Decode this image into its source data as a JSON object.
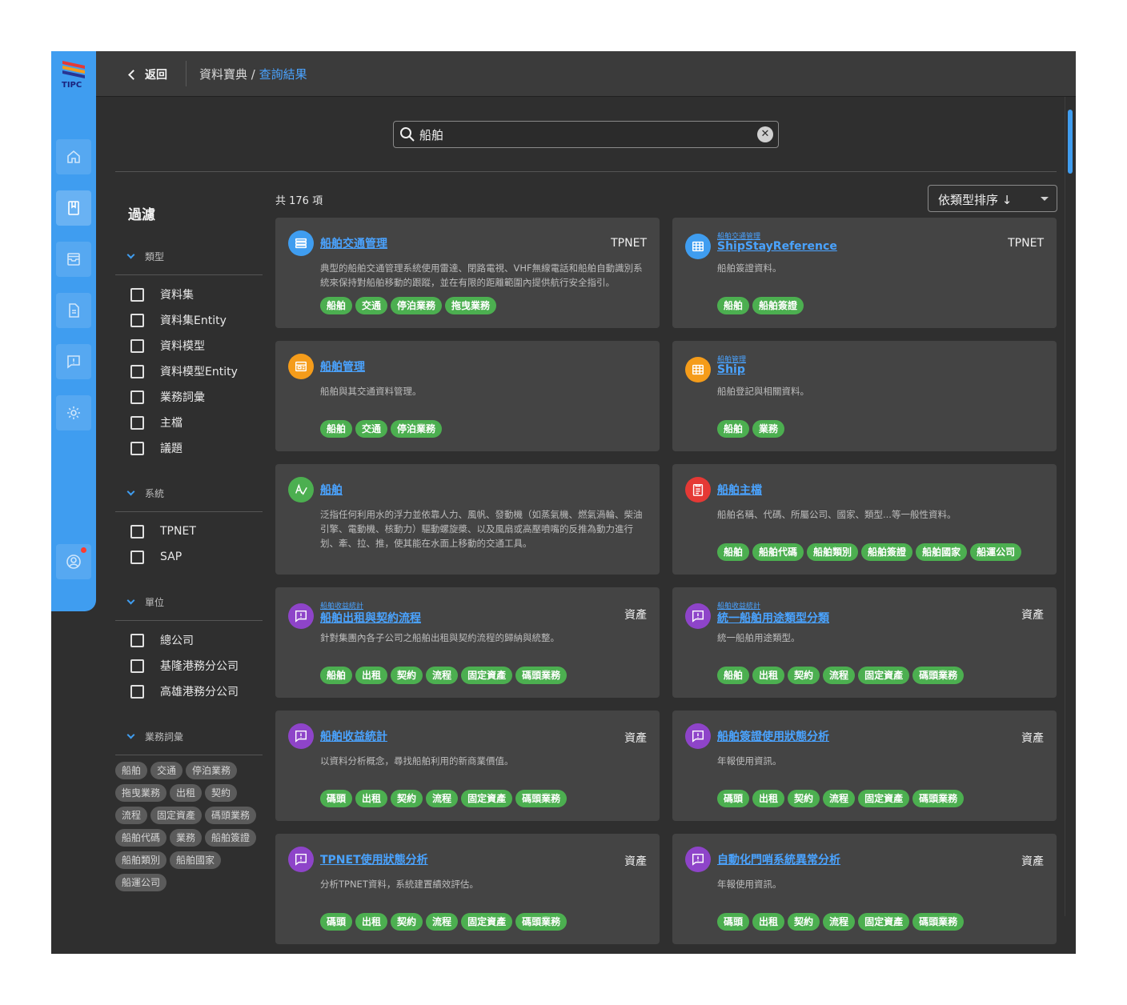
{
  "header": {
    "back_label": "返回",
    "breadcrumb_root": "資料寶典",
    "breadcrumb_sep": " / ",
    "breadcrumb_current": "查詢結果"
  },
  "brand": {
    "logo_text": "TIPC",
    "rail_color": "#3f9df0"
  },
  "rail": {
    "items": [
      "home-icon",
      "book-icon",
      "inbox-icon",
      "document-icon",
      "issue-icon",
      "gear-icon"
    ],
    "account": "account-icon"
  },
  "search": {
    "value": "船舶",
    "placeholder": ""
  },
  "filter": {
    "title": "過濾",
    "sections": [
      {
        "label": "類型",
        "options": [
          "資料集",
          "資料集Entity",
          "資料模型",
          "資料模型Entity",
          "業務詞彙",
          "主檔",
          "議題"
        ]
      },
      {
        "label": "系統",
        "options": [
          "TPNET",
          "SAP"
        ]
      },
      {
        "label": "單位",
        "options": [
          "總公司",
          "基隆港務分公司",
          "高雄港務分公司"
        ]
      },
      {
        "label": "業務詞彙",
        "chips": [
          "船舶",
          "交通",
          "停泊業務",
          "拖曳業務",
          "出租",
          "契約",
          "流程",
          "固定資產",
          "碼頭業務",
          "船舶代碼",
          "業務",
          "船舶簽證",
          "船舶類別",
          "船舶國家",
          "船運公司"
        ]
      }
    ]
  },
  "results": {
    "count_label": "共 176 項",
    "sort_label": "依類型排序 ↓",
    "cards": [
      {
        "icon": "list-icon",
        "color": "#3f9df0",
        "parent": "",
        "title": "船舶交通管理",
        "source": "TPNET",
        "desc": "典型的船舶交通管理系統使用雷達、閉路電視、VHF無線電話和船舶自動識別系統來保持對船舶移動的跟蹤，並在有限的距離範圍內提供航行安全指引。",
        "tags": [
          "船舶",
          "交通",
          "停泊業務",
          "拖曳業務"
        ]
      },
      {
        "icon": "table-icon",
        "color": "#3f9df0",
        "parent": "船舶交通管理",
        "title": "ShipStayReference",
        "source": "TPNET",
        "desc": "船舶簽證資料。",
        "tags": [
          "船舶",
          "船舶簽證"
        ]
      },
      {
        "icon": "model-icon",
        "color": "#f59c1a",
        "parent": "",
        "title": "船舶管理",
        "source": "",
        "desc": "船舶與其交通資料管理。",
        "tags": [
          "船舶",
          "交通",
          "停泊業務"
        ]
      },
      {
        "icon": "table-icon",
        "color": "#f59c1a",
        "parent": "船舶管理",
        "title": "Ship",
        "source": "",
        "desc": "船舶登記與相關資料。",
        "tags": [
          "船舶",
          "業務"
        ]
      },
      {
        "icon": "glossary-icon",
        "color": "#4caf50",
        "parent": "",
        "title": "船舶",
        "source": "",
        "desc": "泛指任何利用水的浮力並依靠人力、風帆、發動機（如蒸氣機、燃氣渦輪、柴油引擎、電動機、核動力）驅動螺旋槳、以及風扇或高壓噴嘴的反推為動力進行划、牽、拉、推，使其能在水面上移動的交通工具。",
        "tags": []
      },
      {
        "icon": "masterfile-icon",
        "color": "#e53935",
        "parent": "",
        "title": "船舶主檔",
        "source": "",
        "desc": "船舶名稱、代碼、所屬公司、國家、類型...等一般性資料。",
        "tags": [
          "船舶",
          "船舶代碼",
          "船舶類別",
          "船舶簽證",
          "船舶國家",
          "船運公司"
        ]
      },
      {
        "icon": "issue-icon",
        "color": "#8e44c9",
        "parent": "船舶收益統計",
        "title": "船舶出租與契約流程",
        "source": "資產",
        "desc": "針對集團內各子公司之船舶出租與契約流程的歸納與統整。",
        "tags": [
          "船舶",
          "出租",
          "契約",
          "流程",
          "固定資產",
          "碼頭業務"
        ]
      },
      {
        "icon": "issue-icon",
        "color": "#8e44c9",
        "parent": "船舶收益統計",
        "title": "統一船舶用途類型分類",
        "source": "資產",
        "desc": "統一船舶用途類型。",
        "tags": [
          "船舶",
          "出租",
          "契約",
          "流程",
          "固定資產",
          "碼頭業務"
        ]
      },
      {
        "icon": "issue-icon",
        "color": "#8e44c9",
        "parent": "",
        "title": "船舶收益統計",
        "source": "資產",
        "desc": "以資料分析概念，尋找船舶利用的新商業價值。",
        "tags": [
          "碼頭",
          "出租",
          "契約",
          "流程",
          "固定資產",
          "碼頭業務"
        ]
      },
      {
        "icon": "issue-icon",
        "color": "#8e44c9",
        "parent": "",
        "title": "船舶簽證使用狀態分析",
        "source": "資產",
        "desc": "年報使用資訊。",
        "tags": [
          "碼頭",
          "出租",
          "契約",
          "流程",
          "固定資產",
          "碼頭業務"
        ]
      },
      {
        "icon": "issue-icon",
        "color": "#8e44c9",
        "parent": "",
        "title": "TPNET使用狀態分析",
        "source": "資產",
        "desc": "分析TPNET資料，系統建置績效評估。",
        "tags": [
          "碼頭",
          "出租",
          "契約",
          "流程",
          "固定資產",
          "碼頭業務"
        ]
      },
      {
        "icon": "issue-icon",
        "color": "#8e44c9",
        "parent": "",
        "title": "自動化門哨系統異常分析",
        "source": "資產",
        "desc": "年報使用資訊。",
        "tags": [
          "碼頭",
          "出租",
          "契約",
          "流程",
          "固定資產",
          "碼頭業務"
        ]
      }
    ]
  }
}
